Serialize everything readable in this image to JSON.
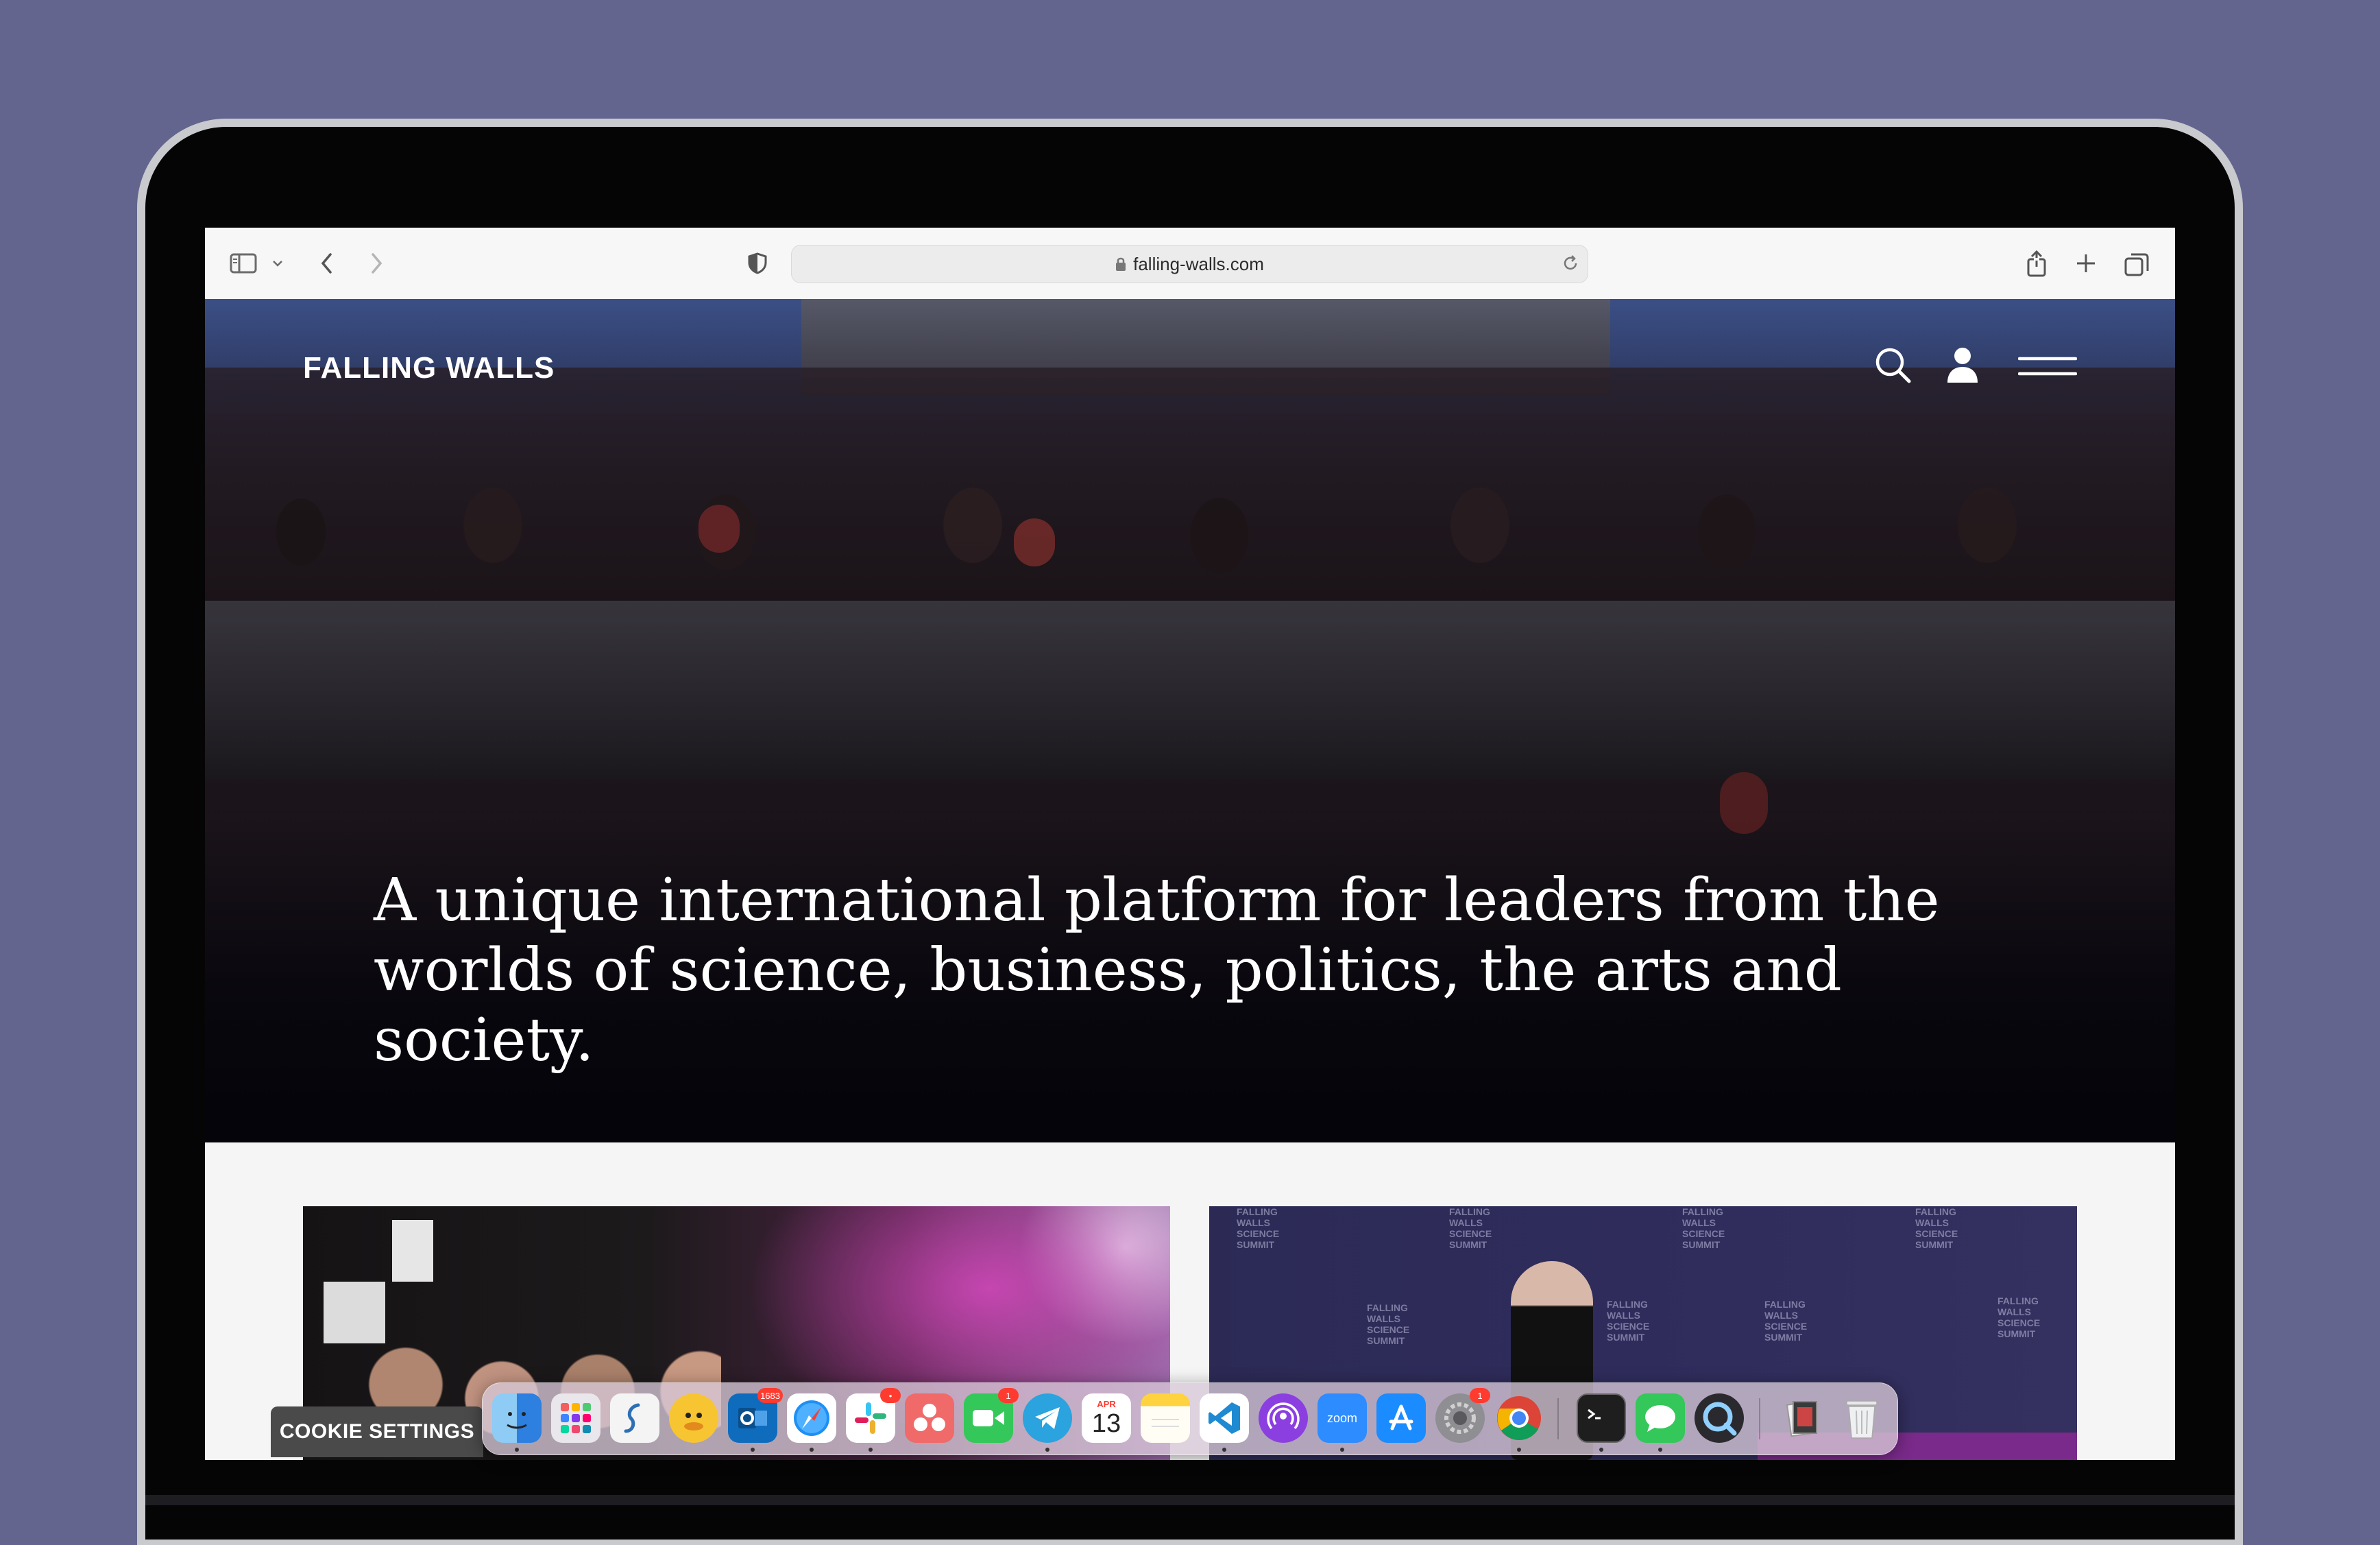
{
  "browser": {
    "url": "falling-walls.com"
  },
  "site": {
    "brand": "FALLING WALLS",
    "headline": "A unique international platform for leaders from the worlds of science, business, politics, the arts and society."
  },
  "cookie": {
    "label": "COOKIE SETTINGS"
  },
  "dock": {
    "apps": [
      {
        "name": "finder",
        "badge": ""
      },
      {
        "name": "launchpad",
        "badge": ""
      },
      {
        "name": "scrivener",
        "badge": ""
      },
      {
        "name": "cyberduck",
        "badge": ""
      },
      {
        "name": "outlook",
        "badge": "1683"
      },
      {
        "name": "safari",
        "badge": ""
      },
      {
        "name": "slack",
        "badge": "•"
      },
      {
        "name": "asana",
        "badge": ""
      },
      {
        "name": "facetime",
        "badge": "1"
      },
      {
        "name": "telegram",
        "badge": ""
      },
      {
        "name": "calendar",
        "badge": "",
        "month": "APR",
        "day": "13"
      },
      {
        "name": "notes",
        "badge": ""
      },
      {
        "name": "vscode",
        "badge": ""
      },
      {
        "name": "podcasts",
        "badge": ""
      },
      {
        "name": "zoom",
        "badge": "",
        "label": "zoom"
      },
      {
        "name": "app-store",
        "badge": ""
      },
      {
        "name": "system-preferences",
        "badge": "1"
      },
      {
        "name": "chrome",
        "badge": ""
      },
      {
        "name": "terminal",
        "badge": ""
      },
      {
        "name": "messages",
        "badge": ""
      },
      {
        "name": "quicktime",
        "badge": ""
      },
      {
        "name": "downloads-stack",
        "badge": ""
      },
      {
        "name": "trash",
        "badge": ""
      }
    ]
  },
  "colors": {
    "background": "#63658f",
    "toolbar": "#f7f7f7",
    "cookie_bg": "#4a4a4a"
  },
  "card2_watermark": "FALLING WALLS SCIENCE SUMMIT"
}
